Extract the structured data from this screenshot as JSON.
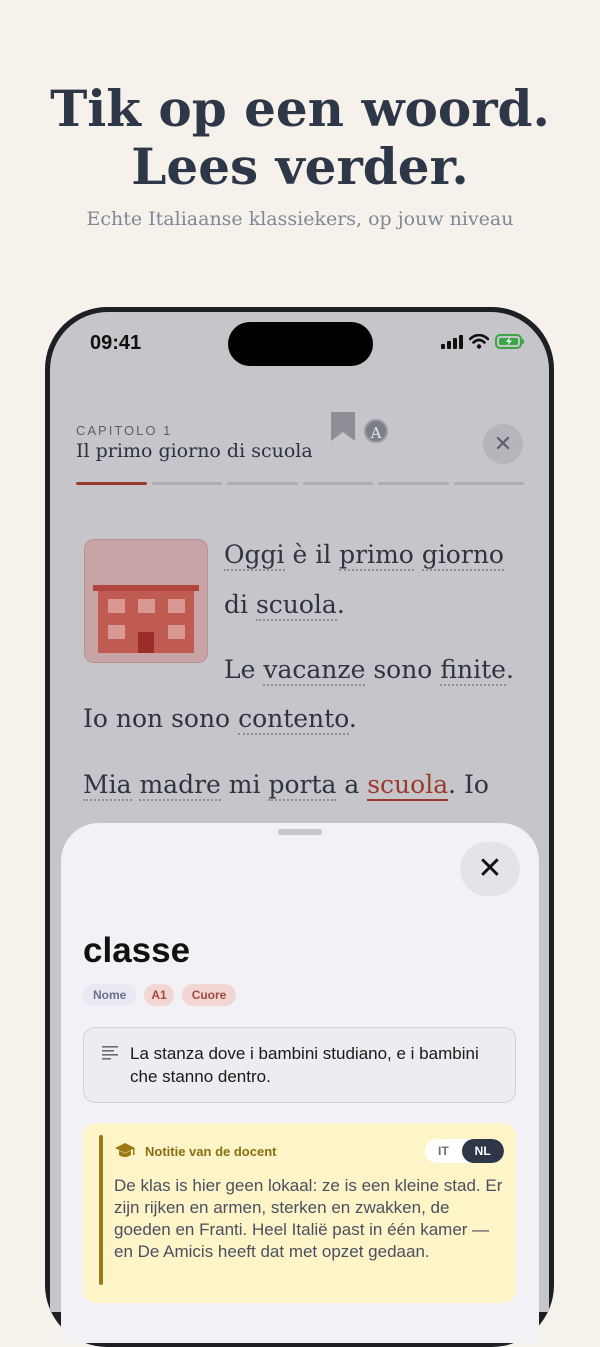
{
  "promo": {
    "title_line1": "Tik op een woord.",
    "title_line2": "Lees verder.",
    "subtitle": "Echte Italiaanse klassiekers, op jouw niveau"
  },
  "status_bar": {
    "time": "09:41"
  },
  "reader": {
    "chapter_label": "CAPITOLO 1",
    "chapter_title": "Il primo giorno di scuola",
    "font_button": "A",
    "progress": {
      "segments": 6,
      "current": 1
    },
    "story": {
      "p1_words": [
        "Oggi",
        "è",
        "il",
        "primo",
        "giorno",
        "di",
        "scuola",
        "."
      ],
      "p1": {
        "a": "Oggi",
        "b": "è il",
        "c": "primo",
        "d": "giorno",
        "e": "di",
        "f": "scuola",
        "g": "."
      },
      "p2": {
        "a": "Le",
        "b": "vacanze",
        "c": "sono",
        "d": "finite",
        "e": ".",
        "f": "Io non sono",
        "g": "contento",
        "h": "."
      },
      "p3": {
        "a": "Mia",
        "b": "madre",
        "c": "mi",
        "d": "porta",
        "e": "a",
        "f": "scuola",
        "g": ". Io"
      }
    }
  },
  "word_sheet": {
    "word": "classe",
    "tags": {
      "part_of_speech": "Nome",
      "level": "A1",
      "source": "Cuore"
    },
    "definition": "La stanza dove i bambini studiano, e i bambini che stanno dentro.",
    "teacher_note": {
      "title": "Notitie van de docent",
      "lang_it": "IT",
      "lang_nl": "NL",
      "active_lang": "NL",
      "text": "De klas is hier geen lokaal: ze is een kleine stad. Er zijn rijken en armen, sterken en zwakken, de goeden en Franti. Heel Italië past in één kamer — en De Amicis heeft dat met opzet gedaan."
    }
  },
  "colors": {
    "background": "#f6f1ea",
    "accent": "#9b3b2e",
    "heading": "#2d3748",
    "note_bg": "#fdf4c8"
  }
}
